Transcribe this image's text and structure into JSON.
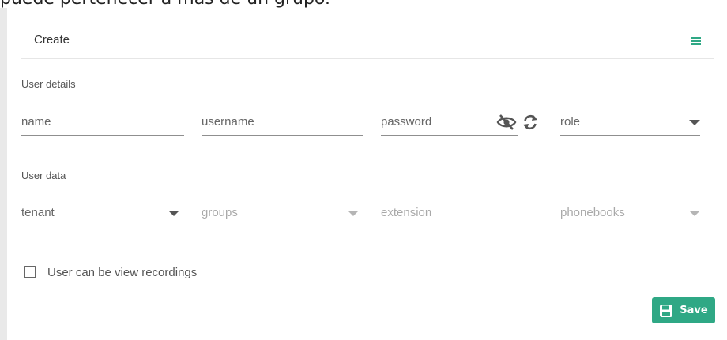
{
  "caption": {
    "text": "puede pertenecer a más de un grupo."
  },
  "header": {
    "title": "Create",
    "menu_icon": "hamburger-menu-icon",
    "accent": "#2fa885"
  },
  "sections": {
    "user_details": {
      "title": "User details"
    },
    "user_data": {
      "title": "User data"
    }
  },
  "fields": {
    "name": {
      "placeholder": "name"
    },
    "username": {
      "placeholder": "username"
    },
    "password": {
      "placeholder": "password",
      "icons": [
        "eye-slash-icon",
        "refresh-icon"
      ]
    },
    "role": {
      "placeholder": "role"
    },
    "tenant": {
      "placeholder": "tenant"
    },
    "groups": {
      "placeholder": "groups"
    },
    "extension": {
      "placeholder": "extension"
    },
    "phonebooks": {
      "placeholder": "phonebooks"
    }
  },
  "checkbox": {
    "label": "User can be view recordings",
    "checked": false
  },
  "save_button": {
    "label": "Save",
    "icon": "floppy-disk-icon",
    "color": "#2fa885"
  }
}
